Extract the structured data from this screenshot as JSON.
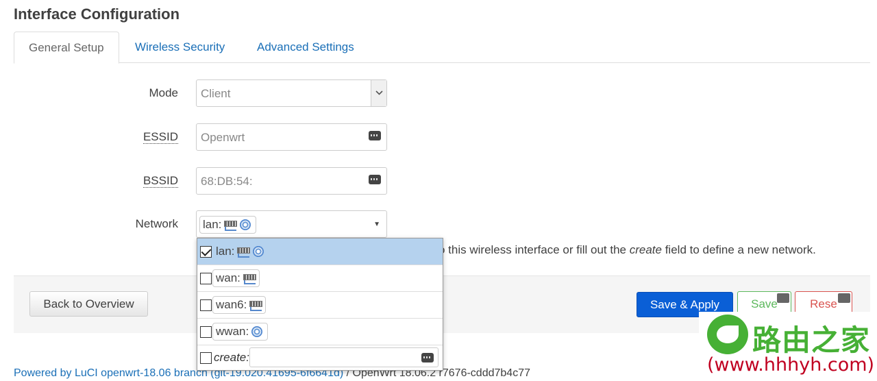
{
  "page": {
    "title": "Interface Configuration"
  },
  "tabs": [
    {
      "label": "General Setup",
      "active": true
    },
    {
      "label": "Wireless Security",
      "active": false
    },
    {
      "label": "Advanced Settings",
      "active": false
    }
  ],
  "form": {
    "mode": {
      "label": "Mode",
      "value": "Client"
    },
    "essid": {
      "label": "ESSID",
      "value": "Openwrt"
    },
    "bssid": {
      "label": "BSSID",
      "value": "68:DB:54:"
    },
    "network": {
      "label": "Network",
      "value": "lan:",
      "help_prefix": "o this wireless interface or fill out the ",
      "help_em": "create",
      "help_suffix": " field to define a new network."
    }
  },
  "network_dropdown": {
    "items": [
      {
        "label": "lan:",
        "checked": true,
        "icons": [
          "ethernet-icon",
          "wifi-icon"
        ]
      },
      {
        "label": "wan:",
        "checked": false,
        "icons": [
          "ethernet-icon"
        ]
      },
      {
        "label": "wan6:",
        "checked": false,
        "icons": [
          "ethernet-icon"
        ]
      },
      {
        "label": "wwan:",
        "checked": false,
        "icons": [
          "wifi-icon"
        ]
      }
    ],
    "create_label": "create:"
  },
  "actions": {
    "back": "Back to Overview",
    "save_apply": "Save & Apply",
    "save": "Save",
    "reset": "Rese"
  },
  "footer": {
    "powered_by": "Powered by LuCI openwrt-18.06 branch (git-19.020.41695-6f6641d)",
    "separator": " / ",
    "version": "OpenWrt 18.06.2 r7676-cddd7b4c77"
  },
  "watermark": {
    "text_cn": "路由之家",
    "url": "(www.hhhyh.com)"
  },
  "colors": {
    "link": "#1a6fb7",
    "primary": "#0a5fd6",
    "save": "#5cb85c",
    "reset": "#d9534f",
    "selected": "#b5d2ee"
  }
}
